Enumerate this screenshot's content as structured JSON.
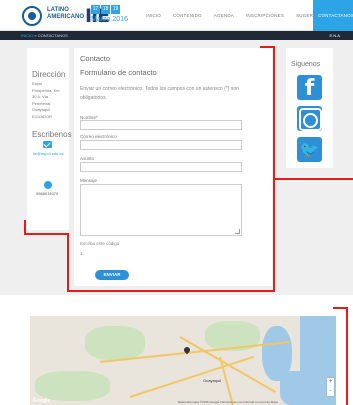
{
  "header": {
    "logo_line1": "LATINO",
    "logo_line2": "AMERICANO",
    "logo_mark": "IIE",
    "date_boxes": [
      "17",
      "18",
      "19"
    ],
    "month": "Marzo 2016",
    "nav": [
      "INICIO",
      "CONTENIDO",
      "AGENDA",
      "INSCRIPCIONES",
      "SUGERENCIAS"
    ],
    "nav_active": "CONTACTANOS"
  },
  "breadcrumb": {
    "home": "INICIO",
    "separator": "»",
    "current": "CONTACTANOS",
    "lang": "E.N.A."
  },
  "left": {
    "direccion_title": "Dirección",
    "direccion_lines": [
      "Espol",
      "Prosperina, Km",
      "30.5, Vía",
      "Perimetral,",
      "Guayaquil",
      "ECUADOR"
    ],
    "escribenos_title": "Escribenos",
    "email": "iie@espol.edu.ec",
    "phone": "0968014070"
  },
  "form": {
    "title": "Contacto",
    "subtitle": "Formulario de contacto",
    "intro": "Enviar un correo electrónico. Todos los campos con un asterisco (*) son obligatorios.",
    "name_label": "Nombre*",
    "email_label": "Correo electrónico",
    "subject_label": "Asunto",
    "message_label": "Mensaje",
    "captcha_label": "Escriba este código",
    "captcha_value": "1",
    "send_label": "ENVIAR"
  },
  "social": {
    "title": "Siguenos",
    "facebook_glyph": "f",
    "twitter_glyph": "🐦"
  },
  "map": {
    "city": "Guayaquil",
    "brand": "Google",
    "footer": "Datos del mapa ©2016 Google   Términos de uso   Informar un error de Maps",
    "zoom_in": "+",
    "zoom_out": "-"
  },
  "colors": {
    "accent": "#2da4e6",
    "button": "#2d8fd6",
    "annotation": "#e31d1d",
    "crumb_bar": "#1f2a36"
  }
}
